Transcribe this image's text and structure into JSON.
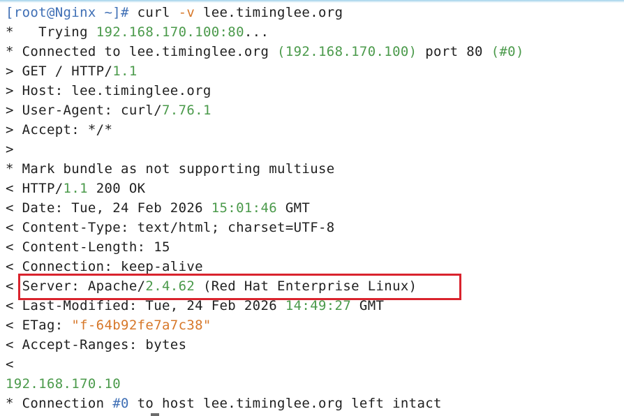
{
  "terminal": {
    "lines": [
      {
        "parts": [
          {
            "text": "[root@Nginx ~]# ",
            "cls": "blue"
          },
          {
            "text": "curl ",
            "cls": ""
          },
          {
            "text": "-v",
            "cls": "orange"
          },
          {
            "text": " lee.timinglee.org",
            "cls": ""
          }
        ]
      },
      {
        "parts": [
          {
            "text": "*   Trying ",
            "cls": ""
          },
          {
            "text": "192.168.170.100:80",
            "cls": "green"
          },
          {
            "text": "...",
            "cls": ""
          }
        ]
      },
      {
        "parts": [
          {
            "text": "* Connected to lee.timinglee.org ",
            "cls": ""
          },
          {
            "text": "(192.168.170.100)",
            "cls": "green"
          },
          {
            "text": " port 80 ",
            "cls": ""
          },
          {
            "text": "(#0)",
            "cls": "green"
          }
        ]
      },
      {
        "parts": [
          {
            "text": "> GET / HTTP/",
            "cls": ""
          },
          {
            "text": "1.1",
            "cls": "green"
          }
        ]
      },
      {
        "parts": [
          {
            "text": "> Host: lee.timinglee.org",
            "cls": ""
          }
        ]
      },
      {
        "parts": [
          {
            "text": "> User-Agent: curl/",
            "cls": ""
          },
          {
            "text": "7.76.1",
            "cls": "green"
          }
        ]
      },
      {
        "parts": [
          {
            "text": "> Accept: */*",
            "cls": ""
          }
        ]
      },
      {
        "parts": [
          {
            "text": ">",
            "cls": ""
          }
        ]
      },
      {
        "parts": [
          {
            "text": "* Mark bundle as not supporting multiuse",
            "cls": ""
          }
        ]
      },
      {
        "parts": [
          {
            "text": "< HTTP/",
            "cls": ""
          },
          {
            "text": "1.1",
            "cls": "green"
          },
          {
            "text": " 200 OK",
            "cls": ""
          }
        ]
      },
      {
        "parts": [
          {
            "text": "< Date: Tue, 24 Feb 2026 ",
            "cls": ""
          },
          {
            "text": "15:01:46",
            "cls": "green"
          },
          {
            "text": " GMT",
            "cls": ""
          }
        ]
      },
      {
        "parts": [
          {
            "text": "< Content-Type: text/html; charset=UTF-8",
            "cls": ""
          }
        ]
      },
      {
        "parts": [
          {
            "text": "< Content-Length: 15",
            "cls": ""
          }
        ]
      },
      {
        "parts": [
          {
            "text": "< Connection: keep-alive",
            "cls": ""
          }
        ]
      },
      {
        "parts": [
          {
            "text": "< Server: Apache/",
            "cls": ""
          },
          {
            "text": "2.4.62",
            "cls": "green"
          },
          {
            "text": " (Red Hat Enterprise Linux)",
            "cls": ""
          }
        ]
      },
      {
        "parts": [
          {
            "text": "< Last-Modified: Tue, 24 Feb 2026 ",
            "cls": ""
          },
          {
            "text": "14:49:27",
            "cls": "green"
          },
          {
            "text": " GMT",
            "cls": ""
          }
        ]
      },
      {
        "parts": [
          {
            "text": "< ETag: ",
            "cls": ""
          },
          {
            "text": "\"f-64b92fe7a7c38\"",
            "cls": "orange"
          }
        ]
      },
      {
        "parts": [
          {
            "text": "< Accept-Ranges: bytes",
            "cls": ""
          }
        ]
      },
      {
        "parts": [
          {
            "text": "<",
            "cls": ""
          }
        ]
      },
      {
        "parts": [
          {
            "text": "192.168.170.10",
            "cls": "green"
          }
        ]
      },
      {
        "parts": [
          {
            "text": "* Connection ",
            "cls": ""
          },
          {
            "text": "#0",
            "cls": "blue"
          },
          {
            "text": " to host lee.timinglee.org left intact",
            "cls": ""
          }
        ]
      }
    ],
    "highlighted_line_index": 14,
    "colors": {
      "text": "#1f1f1f",
      "green": "#4b9a4b",
      "orange": "#d7782a",
      "blue": "#3f6fb5",
      "highlight_border": "#d9232d",
      "background": "#ffffff"
    }
  }
}
